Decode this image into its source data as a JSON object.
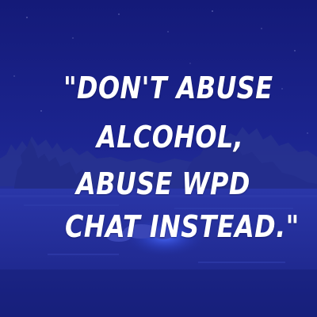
{
  "quote": {
    "lines": [
      "\"DON'T ABUSE",
      "ALCOHOL,",
      "ABUSE WPD",
      "CHAT INSTEAD.\""
    ]
  },
  "colors": {
    "background": "#1a1f8a",
    "text": "#ffffff",
    "glow": "#3a5cff"
  }
}
